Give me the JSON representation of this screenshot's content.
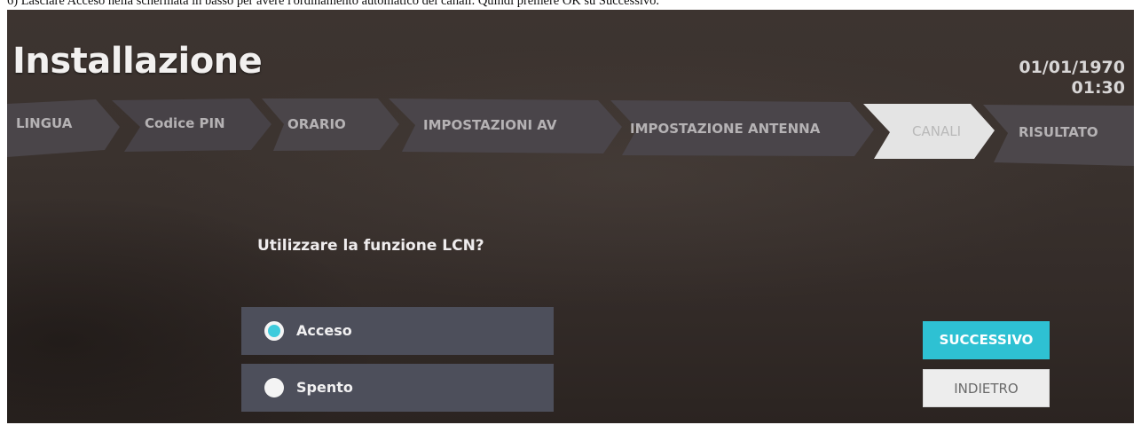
{
  "caption": "6) Lasciare Acceso nella schermata in basso per avere l'ordinamento automatico dei canali. Quindi premere OK su Successivo.",
  "header": {
    "title": "Installazione",
    "date": "01/01/1970",
    "time": "01:30"
  },
  "steps": [
    {
      "label": "LINGUA",
      "active": false
    },
    {
      "label": "Codice PIN",
      "active": false
    },
    {
      "label": "ORARIO",
      "active": false
    },
    {
      "label": "IMPOSTAZIONI AV",
      "active": false
    },
    {
      "label": "IMPOSTAZIONE ANTENNA",
      "active": false
    },
    {
      "label": "CANALI",
      "active": true
    },
    {
      "label": "RISULTATO",
      "active": false
    }
  ],
  "main": {
    "question": "Utilizzare la funzione LCN?",
    "options": [
      {
        "label": "Acceso",
        "selected": true
      },
      {
        "label": "Spento",
        "selected": false
      }
    ]
  },
  "buttons": {
    "next_label": "SUCCESSIVO",
    "back_label": "INDIETRO"
  },
  "colors": {
    "accent": "#2ec1d3",
    "step_inactive": "#4a4549",
    "step_active": "#e4e4e4",
    "option_bg": "#4d4f5b"
  }
}
